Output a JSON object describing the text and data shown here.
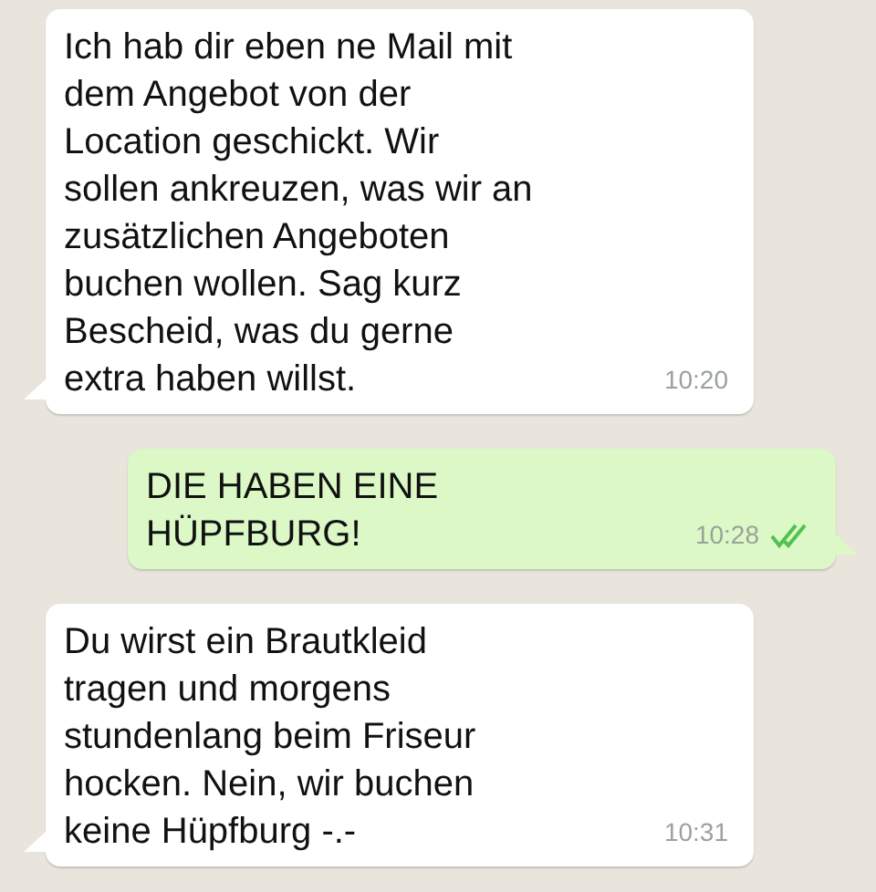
{
  "messages": [
    {
      "kind": "incoming",
      "text": "Ich hab dir eben ne Mail mit\ndem Angebot von der\nLocation geschickt. Wir\nsollen ankreuzen, was wir an\nzusätzlichen Angeboten\nbuchen wollen. Sag kurz\nBescheid, was du gerne\nextra haben willst.",
      "time": "10:20"
    },
    {
      "kind": "outgoing",
      "text": "DIE HABEN EINE\nHÜPFBURG!",
      "time": "10:28",
      "read": true
    },
    {
      "kind": "incoming",
      "text": "Du wirst ein Brautkleid\ntragen und morgens\nstundenlang beim Friseur\nhocken. Nein, wir buchen\nkeine Hüpfburg -.-",
      "time": "10:31"
    }
  ]
}
